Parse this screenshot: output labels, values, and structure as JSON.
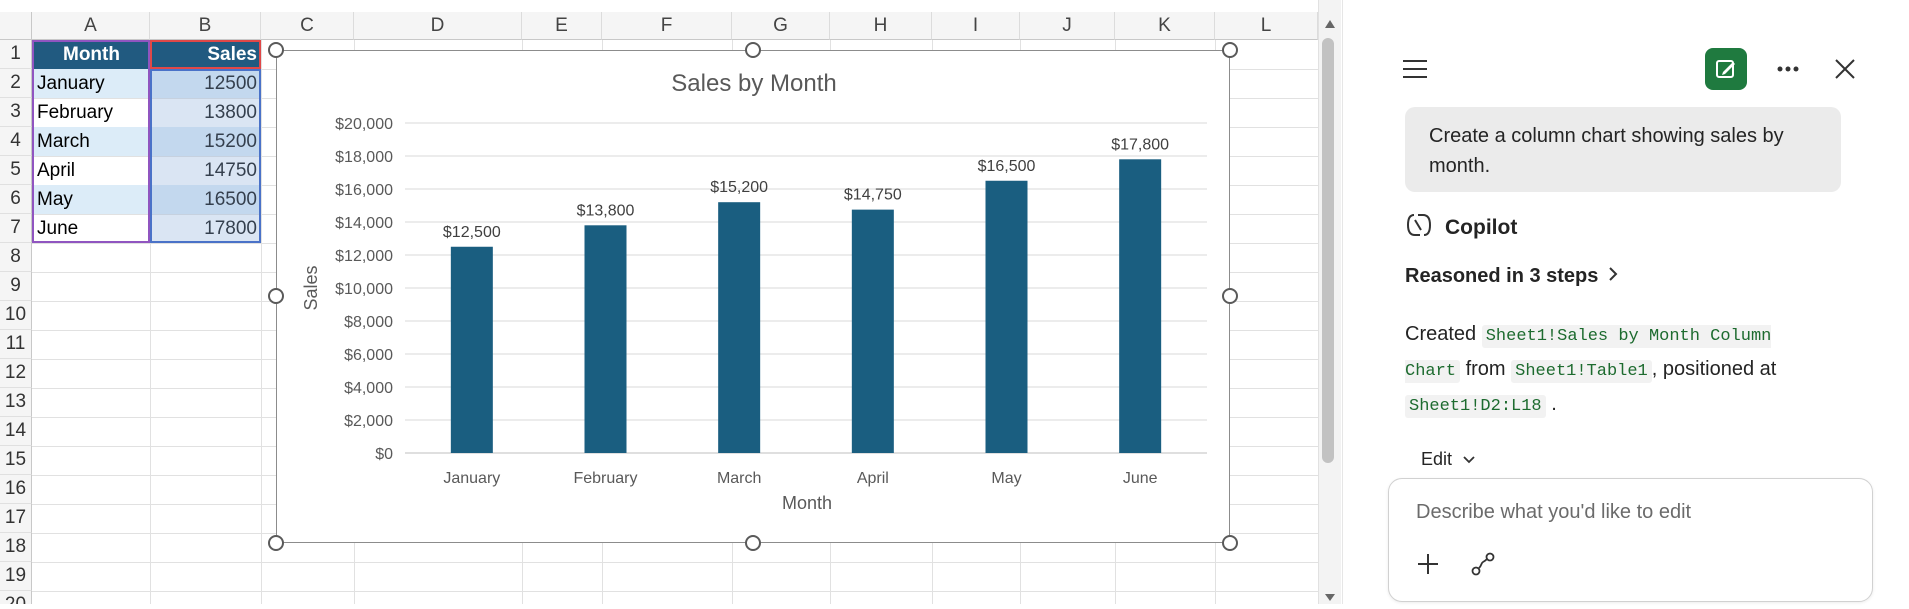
{
  "spreadsheet": {
    "columns": [
      "A",
      "B",
      "C",
      "D",
      "E",
      "F",
      "G",
      "H",
      "I",
      "J",
      "K",
      "L"
    ],
    "rows": [
      "1",
      "2",
      "3",
      "4",
      "5",
      "6",
      "7",
      "8",
      "9",
      "10",
      "11",
      "12",
      "13",
      "14",
      "15",
      "16",
      "17",
      "18",
      "19",
      "20"
    ],
    "table": {
      "headers": [
        "Month",
        "Sales"
      ],
      "rows": [
        [
          "January",
          "12500"
        ],
        [
          "February",
          "13800"
        ],
        [
          "March",
          "15200"
        ],
        [
          "April",
          "14750"
        ],
        [
          "May",
          "16500"
        ],
        [
          "June",
          "17800"
        ]
      ]
    }
  },
  "chart_data": {
    "type": "bar",
    "title": "Sales by Month",
    "xlabel": "Month",
    "ylabel": "Sales",
    "categories": [
      "January",
      "February",
      "March",
      "April",
      "May",
      "June"
    ],
    "values": [
      12500,
      13800,
      15200,
      14750,
      16500,
      17800
    ],
    "data_labels": [
      "$12,500",
      "$13,800",
      "$15,200",
      "$14,750",
      "$16,500",
      "$17,800"
    ],
    "ylim": [
      0,
      20000
    ],
    "yticks": [
      "$0",
      "$2,000",
      "$4,000",
      "$6,000",
      "$8,000",
      "$10,000",
      "$12,000",
      "$14,000",
      "$16,000",
      "$18,000",
      "$20,000"
    ],
    "grid": true,
    "colors": {
      "bar": "#1a5e80"
    }
  },
  "copilot_panel": {
    "user_message": "Create a column chart showing sales by month.",
    "assistant_name": "Copilot",
    "reasoning_label": "Reasoned in 3 steps",
    "response": {
      "t1": "Created",
      "code1": "Sheet1!Sales by Month Column Chart",
      "t2": "from",
      "code2": "Sheet1!Table1",
      "t3": ", positioned at",
      "code3": "Sheet1!D2:L18",
      "t4": "."
    },
    "edit_label": "Edit",
    "input_placeholder": "Describe what you'd like to edit",
    "icons": [
      "menu-icon",
      "new-chat-icon",
      "more-icon",
      "close-icon",
      "copilot-icon",
      "chevron-right-icon",
      "chevron-down-icon",
      "plus-icon",
      "connector-icon"
    ],
    "colors": {
      "accent": "#1f7a3f",
      "code_text": "#1d6b2f"
    }
  }
}
